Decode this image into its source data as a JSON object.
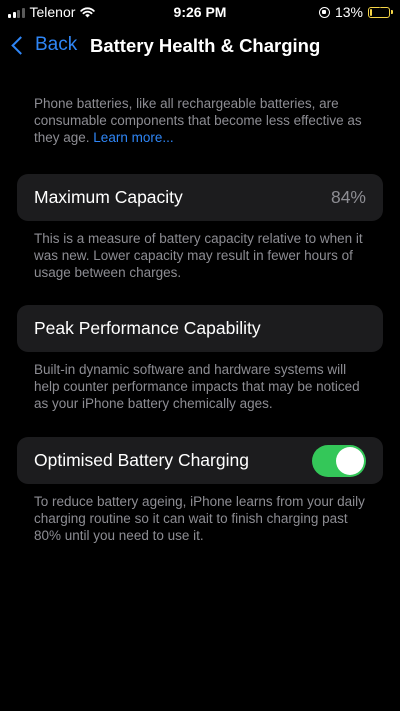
{
  "status_bar": {
    "carrier": "Telenor",
    "time": "9:26 PM",
    "battery_percent": "13%",
    "battery_level": 0.13
  },
  "nav": {
    "back_label": "Back",
    "title": "Battery Health & Charging"
  },
  "intro": {
    "text": "Phone batteries, like all rechargeable batteries, are consumable components that become less effective as they age. ",
    "link": "Learn more..."
  },
  "maximum_capacity": {
    "label": "Maximum Capacity",
    "value": "84%",
    "description": "This is a measure of battery capacity relative to when it was new. Lower capacity may result in fewer hours of usage between charges."
  },
  "peak_performance": {
    "label": "Peak Performance Capability",
    "description": "Built-in dynamic software and hardware systems will help counter performance impacts that may be noticed as your iPhone battery chemically ages."
  },
  "optimised_charging": {
    "label": "Optimised Battery Charging",
    "enabled": true,
    "description": "To reduce battery ageing, iPhone learns from your daily charging routine so it can wait to finish charging past 80% until you need to use it."
  },
  "colors": {
    "accent": "#2f86f6",
    "toggle_on": "#34c759",
    "battery_low": "#f5d547",
    "cell_background": "#1c1c1e",
    "secondary_text": "#8d8d93"
  }
}
